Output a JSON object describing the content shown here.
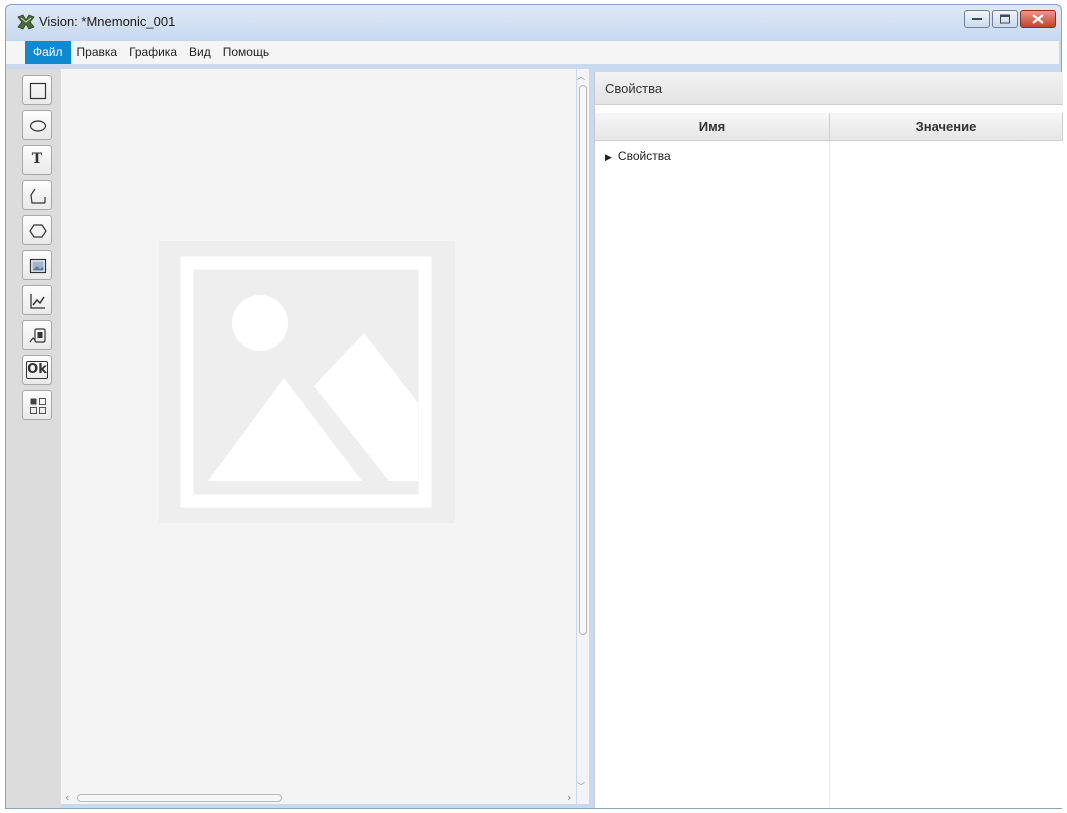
{
  "window": {
    "title": "Vision: *Mnemonic_001"
  },
  "menu": {
    "items": [
      {
        "label": "Файл",
        "active": true
      },
      {
        "label": "Правка"
      },
      {
        "label": "Графика"
      },
      {
        "label": "Вид"
      },
      {
        "label": "Помощь"
      }
    ]
  },
  "toolbar": {
    "tools": [
      {
        "name": "rectangle-tool",
        "icon": "rectangle-icon"
      },
      {
        "name": "ellipse-tool",
        "icon": "ellipse-icon"
      },
      {
        "name": "text-tool",
        "icon": "text-icon",
        "letter": "T"
      },
      {
        "name": "polyline-tool",
        "icon": "polyline-icon"
      },
      {
        "name": "polygon-tool",
        "icon": "hexagon-icon"
      },
      {
        "name": "image-tool",
        "icon": "image-icon"
      },
      {
        "name": "chart-tool",
        "icon": "chart-icon"
      },
      {
        "name": "device-tool",
        "icon": "device-icon"
      },
      {
        "name": "button-tool",
        "icon": "ok-button-icon",
        "letter": "Ok"
      },
      {
        "name": "group-tool",
        "icon": "grid-icon"
      }
    ]
  },
  "properties": {
    "panel_title": "Свойства",
    "columns": {
      "name": "Имя",
      "value": "Значение"
    },
    "tree": [
      {
        "label": "Свойства",
        "expanded": false
      }
    ]
  },
  "colors": {
    "menu_active": "#0f8ad1",
    "toolbar_bg": "#dcdcdc",
    "canvas_bg": "#f4f4f4",
    "window_frame": "#c9daf0"
  }
}
